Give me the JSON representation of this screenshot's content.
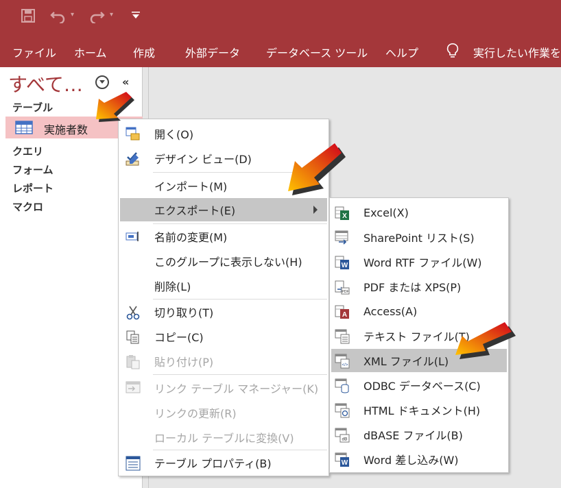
{
  "ribbon": {
    "tabs": [
      "ファイル",
      "ホーム",
      "作成",
      "外部データ",
      "データベース ツール",
      "ヘルプ"
    ],
    "tell_me": "実行したい作業を"
  },
  "nav": {
    "title": "すべて…",
    "categories": {
      "tables": "テーブル",
      "queries": "クエリ",
      "forms": "フォーム",
      "reports": "レポート",
      "macros": "マクロ"
    },
    "selected_item": "実施者数"
  },
  "context_menu": {
    "open": "開く(O)",
    "design_view": "デザイン ビュー(D)",
    "import": "インポート(M)",
    "export": "エクスポート(E)",
    "rename": "名前の変更(M)",
    "hide": "このグループに表示しない(H)",
    "delete": "削除(L)",
    "cut": "切り取り(T)",
    "copy": "コピー(C)",
    "paste": "貼り付け(P)",
    "link_manager": "リンク テーブル マネージャー(K)",
    "refresh_link": "リンクの更新(R)",
    "convert_local": "ローカル テーブルに変換(V)",
    "table_properties": "テーブル プロパティ(B)"
  },
  "export_menu": {
    "excel": "Excel(X)",
    "sharepoint": "SharePoint リスト(S)",
    "word_rtf": "Word RTF ファイル(W)",
    "pdf_xps": "PDF または XPS(P)",
    "access": "Access(A)",
    "text_file": "テキスト ファイル(T)",
    "xml_file": "XML ファイル(L)",
    "odbc": "ODBC データベース(C)",
    "html": "HTML ドキュメント(H)",
    "dbase": "dBASE ファイル(B)",
    "word_merge": "Word 差し込み(W)"
  },
  "colors": {
    "access_brand": "#a4373a",
    "selected_item_bg": "#f5c2c4",
    "menu_highlight": "#c6c6c6",
    "excel_green": "#217346",
    "word_blue": "#2b579a",
    "access_red": "#a4373a"
  }
}
